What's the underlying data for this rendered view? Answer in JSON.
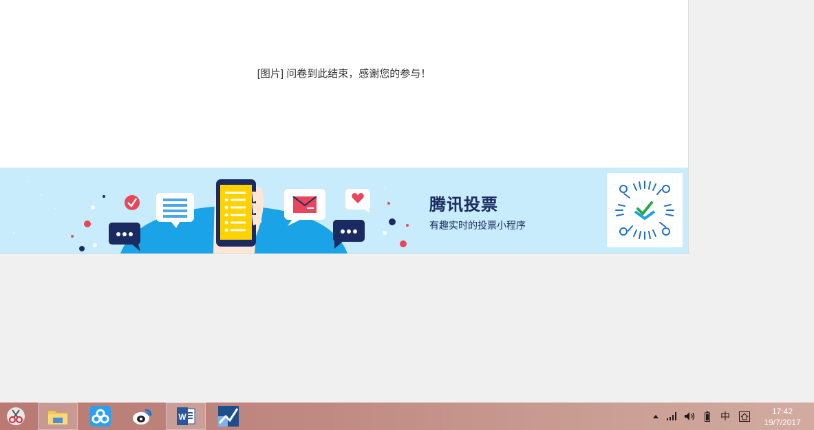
{
  "survey": {
    "end_message": "[图片] 问卷到此结束，感谢您的参与！"
  },
  "banner": {
    "title": "腾讯投票",
    "subtitle": "有趣实时的投票小程序",
    "colors": {
      "background": "#c8ecfb",
      "navy": "#1b2a60",
      "blue": "#1aa3e6",
      "red": "#e8465a",
      "yellow": "#ffd200"
    }
  },
  "taskbar": {
    "items": [
      {
        "name": "start-app",
        "icon": "scissors-icon"
      },
      {
        "name": "file-explorer",
        "icon": "folder-icon"
      },
      {
        "name": "baidu-netdisk",
        "icon": "cloud-icon"
      },
      {
        "name": "weibo",
        "icon": "weibo-icon"
      },
      {
        "name": "word",
        "icon": "word-icon"
      },
      {
        "name": "stock-app",
        "icon": "chart-icon"
      }
    ],
    "tray": {
      "ime": "中",
      "time": "17:42",
      "date": "19/7/2017"
    }
  }
}
